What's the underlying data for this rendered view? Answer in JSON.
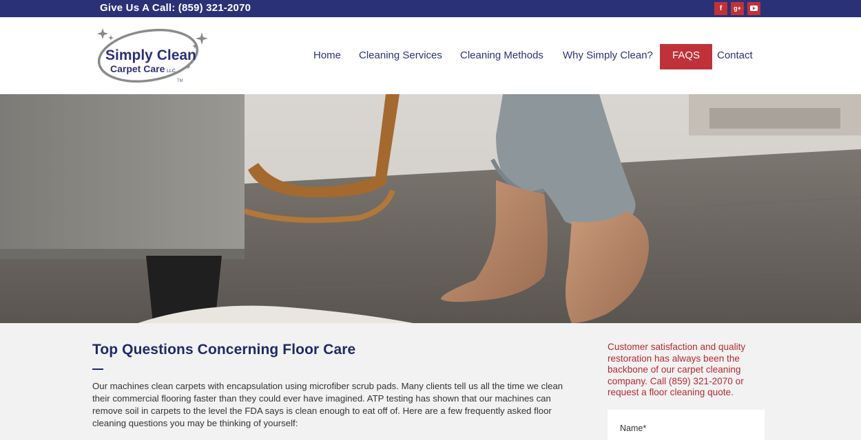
{
  "topbar": {
    "call_text": "Give Us A Call: (859) 321-2070",
    "social": [
      {
        "icon": "facebook-icon",
        "glyph": "f"
      },
      {
        "icon": "google-plus-icon",
        "glyph": "g+"
      },
      {
        "icon": "youtube-icon",
        "glyph": ""
      }
    ],
    "bg_color": "#2a3177",
    "social_color": "#c0323a"
  },
  "logo": {
    "line1": "Simply Clean",
    "line2": "Carpet Care",
    "suffix": "LLC",
    "tm": "TM"
  },
  "nav": {
    "items": [
      {
        "label": "Home"
      },
      {
        "label": "Cleaning Services"
      },
      {
        "label": "Cleaning Methods"
      },
      {
        "label": "Why Simply Clean?"
      },
      {
        "label": "FAQS",
        "active": true
      },
      {
        "label": "Contact"
      }
    ],
    "text_color": "#2a3177",
    "active_bg": "#c0323a"
  },
  "main": {
    "title": "Top Questions Concerning Floor Care",
    "paragraph": "Our machines clean carpets with encapsulation using microfiber scrub pads.  Many clients tell us all the time we clean their commercial flooring faster than they could ever have imagined. ATP testing has shown that our machines can remove soil in carpets to the level the FDA says is clean enough to eat off of. Here are a few frequently asked floor cleaning questions you may be thinking of yourself:"
  },
  "sidebar": {
    "text": "Customer satisfaction and quality restoration has always been the backbone of our carpet cleaning company. Call (859) 321-2070 or request a floor cleaning quote.",
    "name_placeholder": "Name*"
  }
}
